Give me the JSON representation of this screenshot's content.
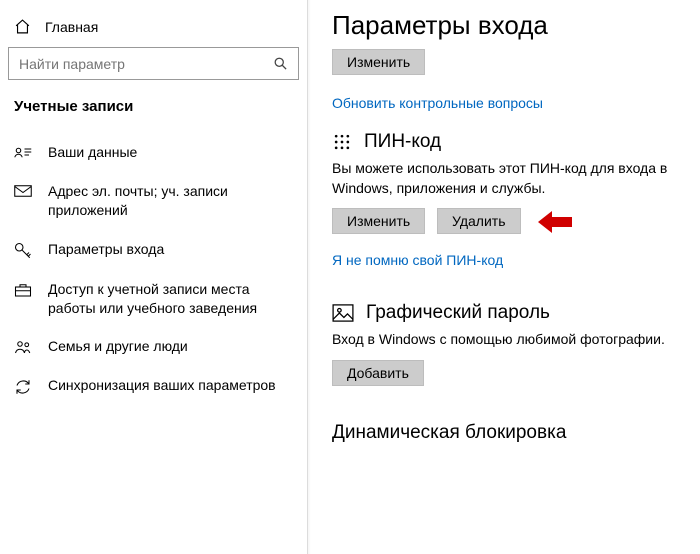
{
  "sidebar": {
    "home": "Главная",
    "search_placeholder": "Найти параметр",
    "section": "Учетные записи",
    "items": [
      "Ваши данные",
      "Адрес эл. почты; уч. записи приложений",
      "Параметры входа",
      "Доступ к учетной записи места работы или учебного заведения",
      "Семья и другие люди",
      "Синхронизация ваших параметров"
    ]
  },
  "main": {
    "title": "Параметры входа",
    "top_button": "Изменить",
    "update_questions_link": "Обновить контрольные вопросы",
    "pin": {
      "heading": "ПИН-код",
      "desc": "Вы можете использовать этот ПИН-код для входа в Windows, приложения и службы.",
      "change": "Изменить",
      "remove": "Удалить",
      "forgot": "Я не помню свой ПИН-код"
    },
    "picture": {
      "heading": "Графический пароль",
      "desc": "Вход в Windows с помощью любимой фотографии.",
      "add": "Добавить"
    },
    "dynamic_lock": "Динамическая блокировка"
  }
}
